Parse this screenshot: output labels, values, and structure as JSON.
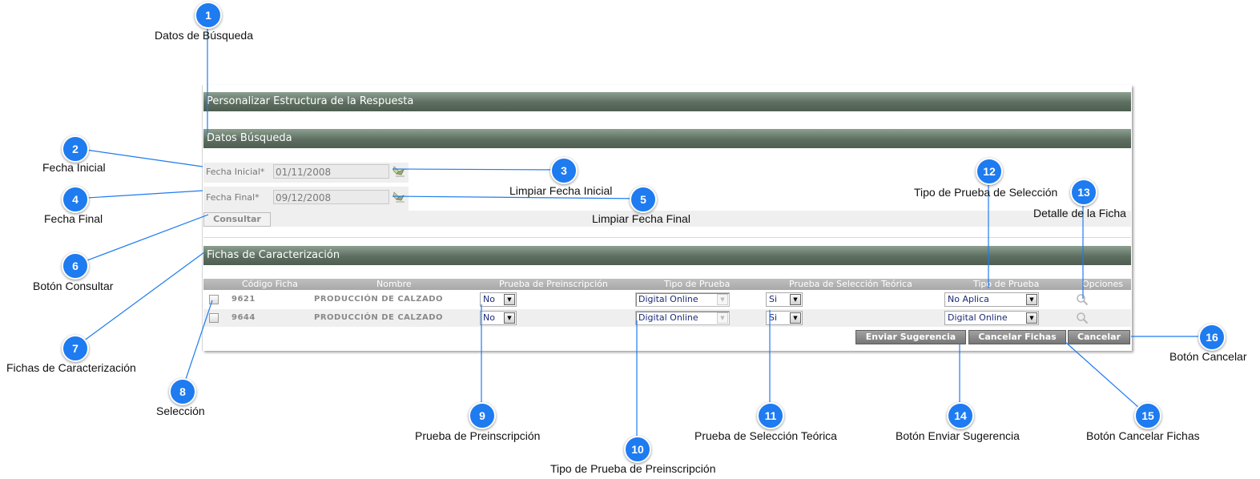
{
  "window": {
    "title": "Personalizar Estructura de la Respuesta"
  },
  "search": {
    "section_title": "Datos Búsqueda",
    "fecha_inicial_label": "Fecha Inicial*",
    "fecha_inicial_value": "01/11/2008",
    "fecha_final_label": "Fecha Final*",
    "fecha_final_value": "09/12/2008",
    "consultar_label": "Consultar",
    "icons": {
      "clear_start": "eraser-icon",
      "clear_end": "eraser-icon"
    }
  },
  "fichas": {
    "section_title": "Fichas de Caracterización",
    "columns": [
      "Código Ficha",
      "Nombre",
      "Prueba de Preinscripción",
      "Tipo de Prueba",
      "Prueba de Selección Teórica",
      "Tipo de Prueba",
      "Opciones"
    ],
    "rows": [
      {
        "codigo": "9621",
        "nombre": "PRODUCCIÓN DE CALZADO",
        "prueba_preinscripcion": "No",
        "tipo_prueba_preinscripcion": "Digital Online",
        "prueba_seleccion_teorica": "Si",
        "tipo_prueba_seleccion": "No Aplica"
      },
      {
        "codigo": "9644",
        "nombre": "PRODUCCIÓN DE CALZADO",
        "prueba_preinscripcion": "No",
        "tipo_prueba_preinscripcion": "Digital Online",
        "prueba_seleccion_teorica": "Si",
        "tipo_prueba_seleccion": "Digital Online"
      }
    ],
    "buttons": {
      "enviar_sugerencia": "Enviar Sugerencia",
      "cancelar_fichas": "Cancelar Fichas",
      "cancelar": "Cancelar"
    },
    "icons": {
      "detalle": "magnifier-icon"
    }
  },
  "annotations": [
    {
      "number": "1",
      "label": "Datos de Búsqueda"
    },
    {
      "number": "2",
      "label": "Fecha Inicial"
    },
    {
      "number": "3",
      "label": "Limpiar Fecha Inicial"
    },
    {
      "number": "4",
      "label": "Fecha Final"
    },
    {
      "number": "5",
      "label": "Limpiar Fecha Final"
    },
    {
      "number": "6",
      "label": "Botón Consultar"
    },
    {
      "number": "7",
      "label": "Fichas de Caracterización"
    },
    {
      "number": "8",
      "label": "Selección"
    },
    {
      "number": "9",
      "label": "Prueba de Preinscripción"
    },
    {
      "number": "10",
      "label": "Tipo de Prueba de Preinscripción"
    },
    {
      "number": "11",
      "label": "Prueba de Selección Teórica"
    },
    {
      "number": "12",
      "label": "Tipo de Prueba de Selección"
    },
    {
      "number": "13",
      "label": "Detalle de la Ficha"
    },
    {
      "number": "14",
      "label": "Botón Enviar Sugerencia"
    },
    {
      "number": "15",
      "label": "Botón Cancelar Fichas"
    },
    {
      "number": "16",
      "label": "Botón Cancelar"
    }
  ],
  "colors": {
    "header_bar": "#5d6e60",
    "badge": "#1e7bf0",
    "callout_line": "#1e7bf0",
    "action_button": "#8a8a8a",
    "select_text": "#1a2a7a"
  }
}
